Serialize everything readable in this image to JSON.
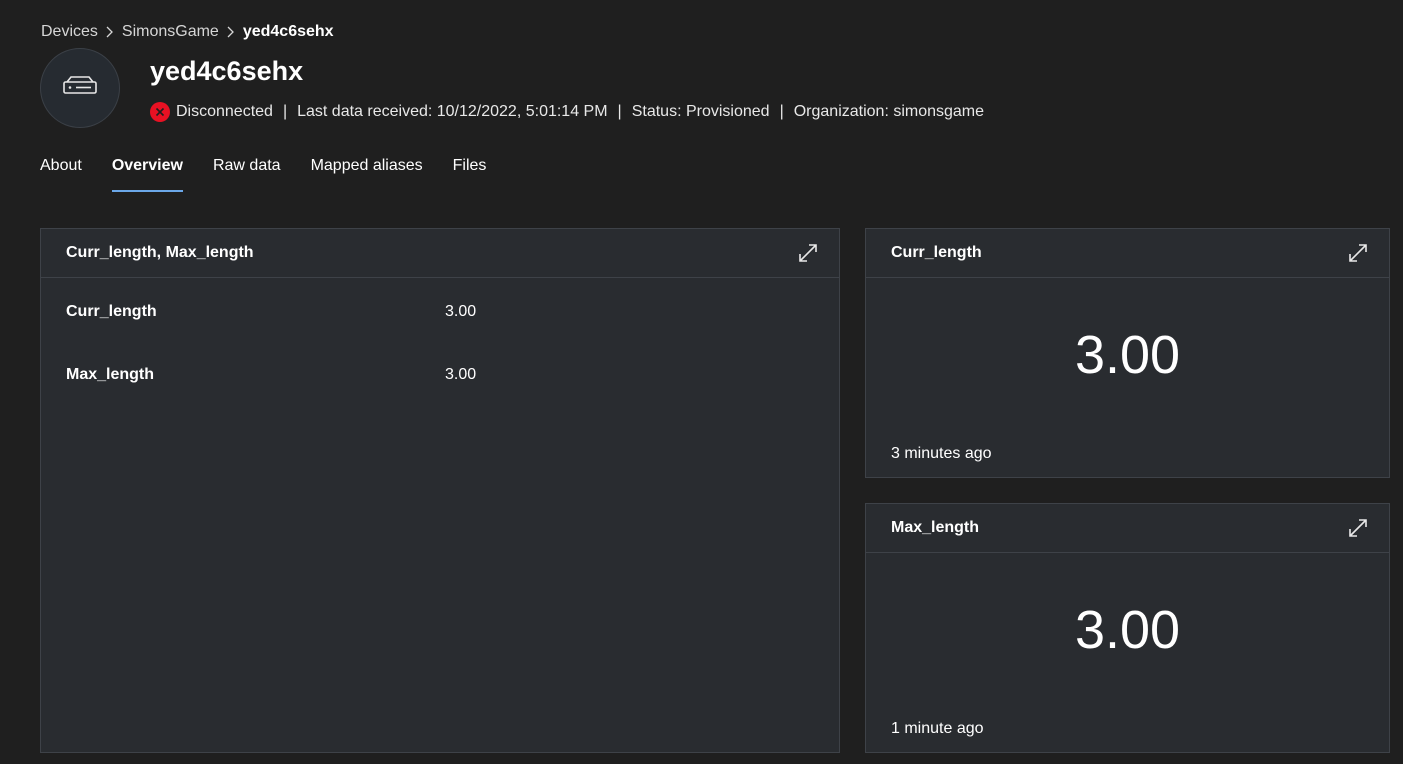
{
  "breadcrumb": {
    "items": [
      "Devices",
      "SimonsGame"
    ],
    "current": "yed4c6sehx"
  },
  "device": {
    "name": "yed4c6sehx",
    "icon": "device-icon",
    "connection": "Disconnected",
    "last_data": "Last data received: 10/12/2022, 5:01:14 PM",
    "status": "Status: Provisioned",
    "organization": "Organization: simonsgame",
    "separator": "|"
  },
  "tabs": [
    {
      "label": "About",
      "active": false
    },
    {
      "label": "Overview",
      "active": true
    },
    {
      "label": "Raw data",
      "active": false
    },
    {
      "label": "Mapped aliases",
      "active": false
    },
    {
      "label": "Files",
      "active": false
    }
  ],
  "tiles": {
    "properties": {
      "title": "Curr_length, Max_length",
      "rows": [
        {
          "name": "Curr_length",
          "value": "3.00"
        },
        {
          "name": "Max_length",
          "value": "3.00"
        }
      ]
    },
    "curr_length": {
      "title": "Curr_length",
      "value": "3.00",
      "updated": "3 minutes ago"
    },
    "max_length": {
      "title": "Max_length",
      "value": "3.00",
      "updated": "1 minute ago"
    }
  },
  "colors": {
    "background": "#1f1f1f",
    "tile": "#292c30",
    "accent": "#6ba7e8",
    "error": "#e81123"
  }
}
